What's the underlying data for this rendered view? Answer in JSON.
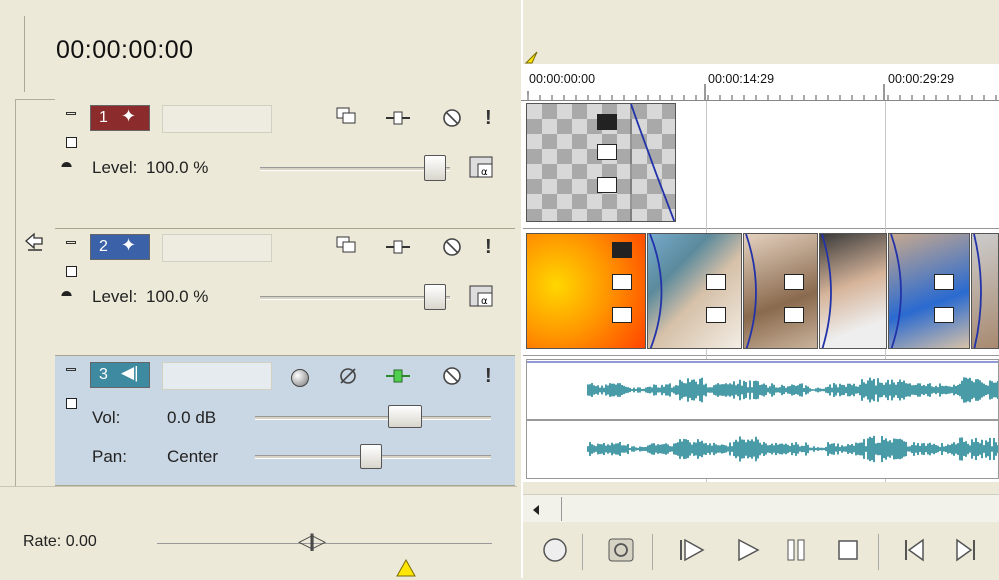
{
  "time_display": "00:00:00:00",
  "ruler": {
    "ticks": [
      "00:00:00:00",
      "00:00:14:29",
      "00:00:29:29"
    ]
  },
  "tracks": [
    {
      "number": "1",
      "kind": "video",
      "color": "#8B2B2B",
      "level_label": "Level:",
      "level_value": "100.0 %",
      "level": 1.0
    },
    {
      "number": "2",
      "kind": "video",
      "color": "#3B62A8",
      "level_label": "Level:",
      "level_value": "100.0 %",
      "level": 1.0
    },
    {
      "number": "3",
      "kind": "audio",
      "color": "#3E8AA0",
      "vol_label": "Vol:",
      "vol_value": "0.0 dB",
      "pan_label": "Pan:",
      "pan_value": "Center"
    }
  ],
  "rate": {
    "label": "Rate: 0.00"
  },
  "icons": {
    "crop": "crop-icon",
    "compositing": "compositing-icon",
    "fx": "track-fx-icon",
    "mute": "mute-icon",
    "solo": "solo-icon",
    "alpha": "alpha-icon",
    "record": "record-icon",
    "invert_phase": "invert-phase-icon"
  },
  "colors": {
    "background": "#ECE9D8",
    "audio_track": "#C9D6E3",
    "waveform": "#4A9BA8",
    "envelope": "#2233AA"
  }
}
